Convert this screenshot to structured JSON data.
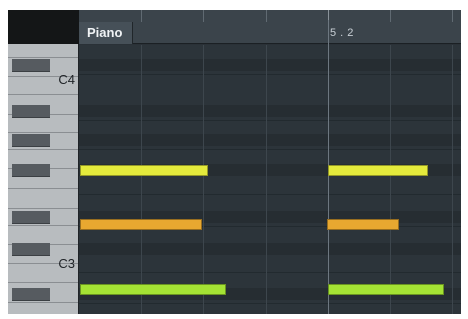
{
  "track": {
    "name": "Piano"
  },
  "ruler": {
    "position_marker": "5 . 2"
  },
  "keyboard": {
    "labels": {
      "c4": "C4",
      "c3": "C3"
    }
  },
  "colors": {
    "note_yellow": "#e4ea3c",
    "note_orange": "#e8a830",
    "note_lime": "#a4e234"
  },
  "notes": [
    {
      "lane": "upper",
      "color": "note_yellow",
      "bar": 1
    },
    {
      "lane": "upper",
      "color": "note_yellow",
      "bar": 2
    },
    {
      "lane": "middle",
      "color": "note_orange",
      "bar": 1
    },
    {
      "lane": "middle",
      "color": "note_orange",
      "bar": 2
    },
    {
      "lane": "lower",
      "color": "note_lime",
      "bar": 1
    },
    {
      "lane": "lower",
      "color": "note_lime",
      "bar": 2
    }
  ]
}
